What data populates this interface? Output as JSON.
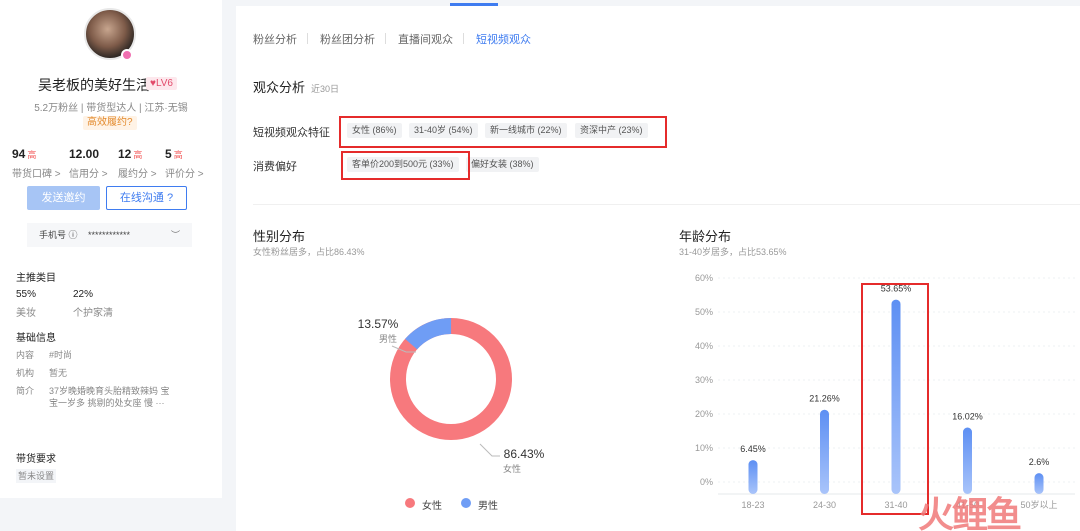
{
  "profile": {
    "name": "吴老板的美好生活",
    "level": "♥LV6",
    "sub": "5.2万粉丝 | 带货型达人 | 江苏·无锡",
    "tag": "高效履约?",
    "stats": [
      {
        "value": "94",
        "hi": "高",
        "label": "带货口碑 >"
      },
      {
        "value": "12.00",
        "hi": "",
        "label": "信用分 >"
      },
      {
        "value": "12",
        "hi": "高",
        "label": "履约分 >"
      },
      {
        "value": "5",
        "hi": "高",
        "label": "评价分 >"
      }
    ],
    "invite_btn": "发送邀约",
    "chat_btn": "在线沟通 ?",
    "phone_label": "手机号 ⓘ",
    "phone_value": "************",
    "main_cat_title": "主推类目",
    "categories": [
      {
        "pct": "55%",
        "name": "美妆"
      },
      {
        "pct": "22%",
        "name": "个护家清"
      }
    ],
    "basic_title": "基础信息",
    "info": [
      {
        "k": "内容",
        "v": "#时尚"
      },
      {
        "k": "机构",
        "v": "暂无"
      },
      {
        "k": "简介",
        "v": "37岁晚婚晚育头胎精致辣妈 宝"
      },
      {
        "k": "",
        "v": "宝一岁多 挑剔的处女座 慢 ···"
      }
    ],
    "req_title": "带货要求",
    "req_tag": "暂未设置"
  },
  "tabs": [
    "粉丝分析",
    "粉丝团分析",
    "直播间观众",
    "短视频观众"
  ],
  "audience": {
    "title": "观众分析",
    "period": "近30日",
    "feature_label": "短视频观众特征",
    "features": [
      "女性 (86%)",
      "31-40岁 (54%)",
      "新一线城市 (22%)",
      "资深中产 (23%)"
    ],
    "pref_label": "消费偏好",
    "prefs": [
      "客单价200到500元 (33%)",
      "偏好女装 (38%)"
    ]
  },
  "gender": {
    "title": "性别分布",
    "desc": "女性粉丝居多，占比86.43%",
    "female_pct_label": "86.43%",
    "female_label": "女性",
    "male_pct_label": "13.57%",
    "male_label": "男性",
    "legend": [
      "女性",
      "男性"
    ]
  },
  "age": {
    "title": "年龄分布",
    "desc": "31-40岁居多，占比53.65%"
  },
  "colors": {
    "female": "#f7797d",
    "male": "#6f9df5",
    "accent": "#3f7cf0",
    "highlight": "#e52b2b"
  },
  "chart_data": [
    {
      "type": "pie",
      "title": "性别分布",
      "categories": [
        "女性",
        "男性"
      ],
      "values": [
        86.43,
        13.57
      ]
    },
    {
      "type": "bar",
      "title": "年龄分布",
      "categories": [
        "18-23",
        "24-30",
        "31-40",
        "41-50",
        "50岁以上"
      ],
      "values": [
        6.45,
        21.26,
        53.65,
        16.02,
        2.6
      ],
      "value_labels": [
        "6.45%",
        "21.26%",
        "53.65%",
        "16.02%",
        "2.6%"
      ],
      "yticks": [
        "0%",
        "10%",
        "20%",
        "30%",
        "40%",
        "50%",
        "60%"
      ],
      "ylim": [
        0,
        60
      ],
      "highlight": "31-40"
    }
  ],
  "watermark": "火鲤鱼"
}
